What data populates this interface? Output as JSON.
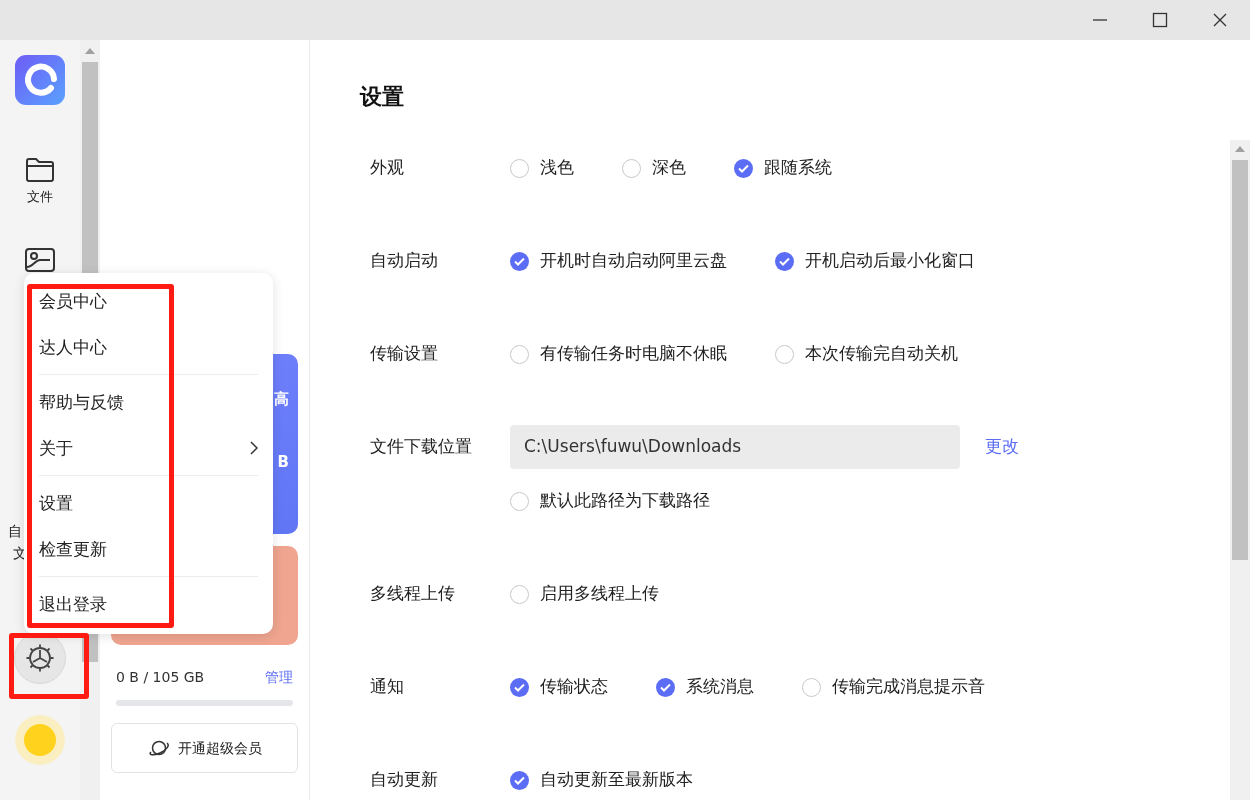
{
  "rail": {
    "items": [
      {
        "kind": "folder",
        "label": "文件"
      },
      {
        "kind": "photo"
      }
    ],
    "covered_label": [
      "自",
      "文"
    ]
  },
  "side_panel": {
    "cards": [
      {
        "kind": "member",
        "texts": [
          "高",
          "B"
        ]
      },
      {
        "kind": "promo"
      }
    ],
    "storage": {
      "used": "0 B / 105 GB",
      "manage": "管理",
      "level": 0
    },
    "vip_button": "开通超级会员"
  },
  "menu": {
    "groups": [
      [
        {
          "label": "会员中心",
          "submenu": false
        },
        {
          "label": "达人中心",
          "submenu": false
        }
      ],
      [
        {
          "label": "帮助与反馈",
          "submenu": false
        },
        {
          "label": "关于",
          "submenu": true
        }
      ],
      [
        {
          "label": "设置",
          "submenu": false
        },
        {
          "label": "检查更新",
          "submenu": false
        }
      ],
      [
        {
          "label": "退出登录",
          "submenu": false
        }
      ]
    ]
  },
  "settings": {
    "title": "设置",
    "rows": [
      {
        "label": "外观",
        "lines": [
          {
            "kind": "options",
            "options": [
              {
                "label": "浅色",
                "checked": false
              },
              {
                "label": "深色",
                "checked": false
              },
              {
                "label": "跟随系统",
                "checked": true
              }
            ]
          }
        ]
      },
      {
        "label": "自动启动",
        "lines": [
          {
            "kind": "options",
            "options": [
              {
                "label": "开机时自动启动阿里云盘",
                "checked": true
              },
              {
                "label": "开机启动后最小化窗口",
                "checked": true
              }
            ]
          }
        ]
      },
      {
        "label": "传输设置",
        "lines": [
          {
            "kind": "options",
            "options": [
              {
                "label": "有传输任务时电脑不休眠",
                "checked": false
              },
              {
                "label": "本次传输完自动关机",
                "checked": false
              }
            ]
          }
        ]
      },
      {
        "label": "文件下载位置",
        "lines": [
          {
            "kind": "path",
            "value": "C:\\Users\\fuwu\\Downloads",
            "action": "更改"
          },
          {
            "kind": "options",
            "options": [
              {
                "label": "默认此路径为下载路径",
                "checked": false
              }
            ]
          }
        ]
      },
      {
        "label": "多线程上传",
        "lines": [
          {
            "kind": "options",
            "options": [
              {
                "label": "启用多线程上传",
                "checked": false
              }
            ]
          }
        ]
      },
      {
        "label": "通知",
        "lines": [
          {
            "kind": "options",
            "options": [
              {
                "label": "传输状态",
                "checked": true
              },
              {
                "label": "系统消息",
                "checked": true
              },
              {
                "label": "传输完成消息提示音",
                "checked": false
              }
            ]
          }
        ]
      },
      {
        "label": "自动更新",
        "lines": [
          {
            "kind": "options",
            "options": [
              {
                "label": "自动更新至最新版本",
                "checked": true
              }
            ]
          }
        ]
      }
    ]
  }
}
